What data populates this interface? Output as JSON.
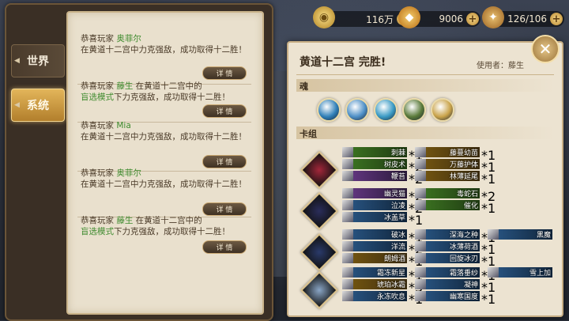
{
  "resources": [
    {
      "icon": "coin-icon",
      "value": "116万"
    },
    {
      "icon": "diamond-icon",
      "value": "9006"
    },
    {
      "icon": "stamina-icon",
      "value": "126/106"
    }
  ],
  "tabs": {
    "world": "世界",
    "system": "系统"
  },
  "log": {
    "detail_label": "详 情",
    "entries": [
      {
        "pre": "恭喜玩家 ",
        "name": "奥菲尔",
        "post": "在黄道十二宫中力克强敌，成功取得十二胜！"
      },
      {
        "pre": "恭喜玩家 ",
        "name": "藤生",
        "mid": " 在黄道十二宫中的",
        "mode": "盲选模式",
        "post": "下力克强敌，成功取得十二胜！"
      },
      {
        "pre": "恭喜玩家 ",
        "name": "Mia",
        "post": "在黄道十二宫中力克强敌，成功取得十二胜！"
      },
      {
        "pre": "恭喜玩家 ",
        "name": "奥菲尔",
        "post": "在黄道十二宫中力克强敌，成功取得十二胜！"
      },
      {
        "pre": "恭喜玩家 ",
        "name": "藤生",
        "mid": " 在黄道十二宫中的",
        "mode": "盲选模式",
        "post": "下力克强敌，成功取得十二胜！"
      }
    ]
  },
  "result": {
    "title": "黄道十二宫 完胜!",
    "user": "使用者：藤生",
    "soul_label": "魂",
    "deck_label": "卡组",
    "souls": [
      "#2f7fb8",
      "#4d8fc6",
      "#3a9ac4",
      "#5a7a3a",
      "#c9a34a"
    ],
    "heroes": [
      {
        "color": "#a3273a",
        "cards": [
          {
            "name": "刺棘",
            "count": "1",
            "c": "green"
          },
          {
            "name": "藤蔓幼苗",
            "count": "1",
            "c": "gold"
          },
          {
            "name": "树皮术",
            "count": "2",
            "c": "green"
          },
          {
            "name": "万藤护体",
            "count": "1",
            "c": "gold"
          },
          {
            "name": "鞭苔",
            "count": "2",
            "c": "purple"
          },
          {
            "name": "林薄延尾",
            "count": "1",
            "c": "gold"
          }
        ]
      },
      {
        "color": "#2a2d5a",
        "cards": [
          {
            "name": "幽灵猫",
            "count": "2",
            "c": "purple"
          },
          {
            "name": "毒蛇石",
            "count": "2",
            "c": "green"
          },
          {
            "name": "泣凌",
            "count": "2",
            "c": "blue"
          },
          {
            "name": "催化",
            "count": "1",
            "c": "green"
          },
          {
            "name": "冰盖草",
            "count": "1",
            "c": "blue"
          }
        ]
      },
      {
        "color": "#2a3a6a",
        "cards": [
          {
            "name": "破冰",
            "count": "1",
            "c": "blue"
          },
          {
            "name": "深海之种",
            "count": "1",
            "c": "blue"
          },
          {
            "name": "黑魔",
            "count": "",
            "c": "blue"
          },
          {
            "name": "洋流",
            "count": "2",
            "c": "blue"
          },
          {
            "name": "冰薄荷酒",
            "count": "1",
            "c": "blue"
          },
          {
            "name": "朗姆酒",
            "count": "1",
            "c": "gold"
          },
          {
            "name": "回旋冰刃",
            "count": "1",
            "c": "blue"
          }
        ]
      },
      {
        "color": "#8aa6c6",
        "cards": [
          {
            "name": "霜冻新星",
            "count": "1",
            "c": "blue"
          },
          {
            "name": "霜落垂纱",
            "count": "1",
            "c": "blue"
          },
          {
            "name": "雪上加",
            "count": "",
            "c": "blue"
          },
          {
            "name": "琥珀冰霜",
            "count": "3",
            "c": "gold"
          },
          {
            "name": "凝神",
            "count": "1",
            "c": "blue"
          },
          {
            "name": "永冻吹息",
            "count": "1",
            "c": "blue"
          },
          {
            "name": "幽寒国度",
            "count": "1",
            "c": "blue"
          }
        ]
      }
    ]
  }
}
